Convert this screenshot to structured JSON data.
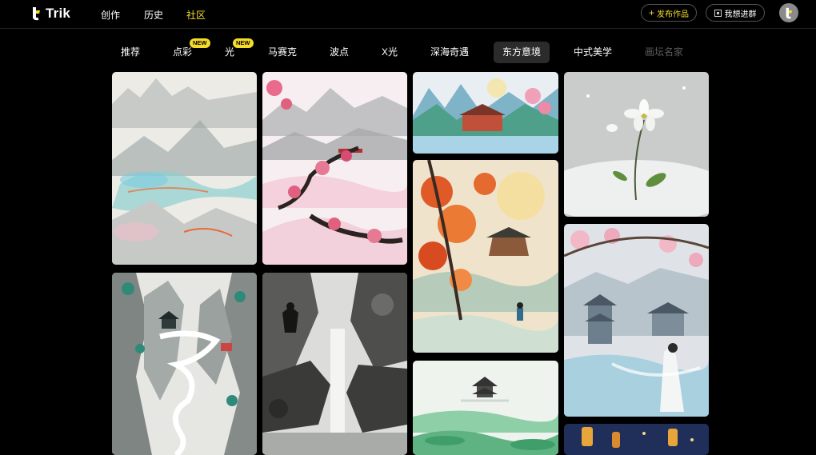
{
  "header": {
    "logo_text": "Trik",
    "nav": [
      {
        "label": "创作",
        "active": false
      },
      {
        "label": "历史",
        "active": false
      },
      {
        "label": "社区",
        "active": true
      }
    ],
    "publish_label": "发布作品",
    "join_group_label": "我想进群"
  },
  "categories": [
    {
      "label": "推荐",
      "badge": ""
    },
    {
      "label": "点彩",
      "badge": "NEW"
    },
    {
      "label": "光",
      "badge": "NEW"
    },
    {
      "label": "马赛克",
      "badge": ""
    },
    {
      "label": "波点",
      "badge": ""
    },
    {
      "label": "X光",
      "badge": ""
    },
    {
      "label": "深海奇遇",
      "badge": ""
    },
    {
      "label": "东方意境",
      "badge": "",
      "selected": true
    },
    {
      "label": "中式美学",
      "badge": ""
    },
    {
      "label": "画坛名家",
      "badge": ""
    }
  ],
  "gallery": [
    {
      "subject": "ink-landscape-river"
    },
    {
      "subject": "plum-blossom-mountains"
    },
    {
      "subject": "temple-lake-blossom"
    },
    {
      "subject": "snow-flower"
    },
    {
      "subject": "cliff-pavilion-path"
    },
    {
      "subject": "waterfall-warrior"
    },
    {
      "subject": "autumn-maple-moon"
    },
    {
      "subject": "pavilion-sakura-lady"
    },
    {
      "subject": "misty-pagoda-green"
    },
    {
      "subject": "lanterns-night"
    }
  ],
  "colors": {
    "accent": "#f5dc29",
    "background": "#000000",
    "selected_tab_bg": "#2b2b2b",
    "dim_tab_text": "#5c5c5c"
  }
}
